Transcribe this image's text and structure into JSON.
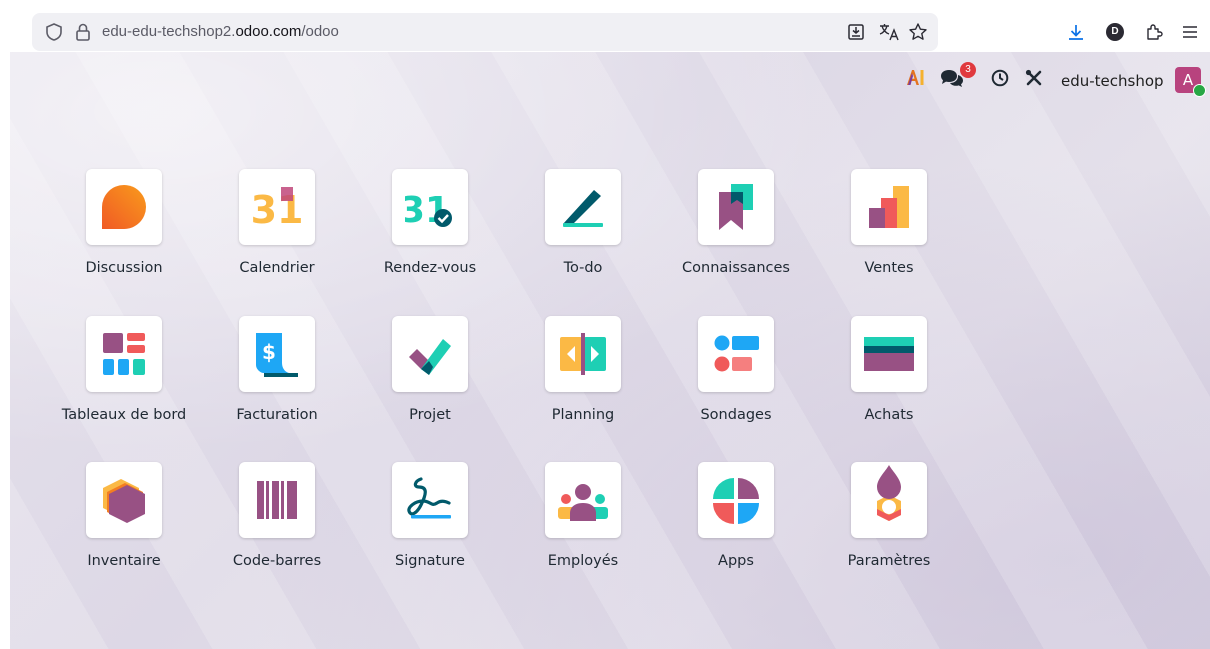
{
  "browser": {
    "url_prefix": "edu-edu-techshop2.",
    "url_domain": "odoo.com",
    "url_path": "/odoo",
    "profile_initial": "D"
  },
  "systray": {
    "ai_label": "AI",
    "messages_count": "3",
    "company": "edu-techshop",
    "user_initial": "A"
  },
  "apps": [
    {
      "label": "Discussion"
    },
    {
      "label": "Calendrier",
      "icon_text": "31"
    },
    {
      "label": "Rendez-vous",
      "icon_text": "31"
    },
    {
      "label": "To-do"
    },
    {
      "label": "Connaissances"
    },
    {
      "label": "Ventes"
    },
    {
      "label": "Tableaux de bord"
    },
    {
      "label": "Facturation",
      "icon_text": "$"
    },
    {
      "label": "Projet"
    },
    {
      "label": "Planning"
    },
    {
      "label": "Sondages"
    },
    {
      "label": "Achats"
    },
    {
      "label": "Inventaire"
    },
    {
      "label": "Code-barres"
    },
    {
      "label": "Signature"
    },
    {
      "label": "Employés"
    },
    {
      "label": "Apps"
    },
    {
      "label": "Paramètres"
    }
  ],
  "colors": {
    "odoo_purple": "#875a7b",
    "orange": "#f37e21",
    "teal": "#1ecfb4",
    "blue": "#1ea7f5",
    "red": "#f05a5a",
    "yellow": "#fbb945",
    "dark_teal": "#015a6b"
  }
}
